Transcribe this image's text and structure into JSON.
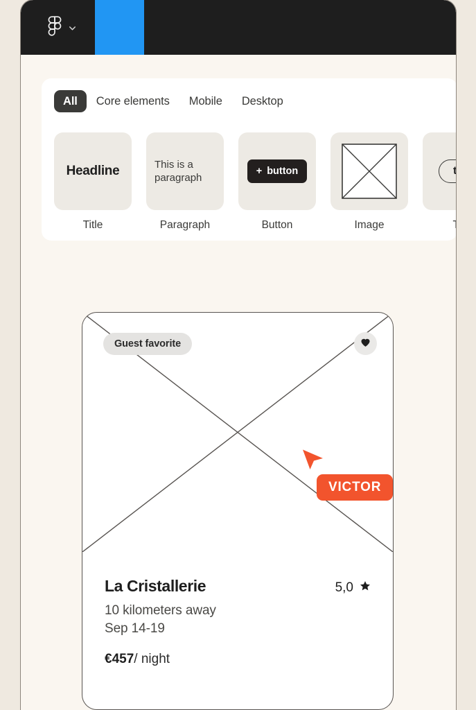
{
  "window": {
    "topbar": {
      "logo_icon": "figma-logo-icon",
      "dropdown_icon": "chevron-down-icon",
      "active_tab_color": "#2196F3"
    }
  },
  "elements_panel": {
    "tabs": [
      {
        "label": "All",
        "active": true
      },
      {
        "label": "Core elements",
        "active": false
      },
      {
        "label": "Mobile",
        "active": false
      },
      {
        "label": "Desktop",
        "active": false
      }
    ],
    "cards": [
      {
        "caption": "Title",
        "preview": "Headline",
        "kind": "headline"
      },
      {
        "caption": "Paragraph",
        "preview": "This is a paragraph",
        "kind": "paragraph"
      },
      {
        "caption": "Button",
        "preview": "button",
        "plus": "+",
        "kind": "button"
      },
      {
        "caption": "Image",
        "preview": "",
        "kind": "image"
      },
      {
        "caption": "Tag",
        "preview": "tag",
        "kind": "tag"
      }
    ]
  },
  "listing_card": {
    "badge": "Guest favorite",
    "favorite_icon": "heart-icon",
    "title": "La Cristallerie",
    "rating": "5,0",
    "rating_icon": "star-icon",
    "distance": "10 kilometers away",
    "dates": "Sep 14-19",
    "price_amount": "€457",
    "price_unit": "/ night"
  },
  "cursor": {
    "label": "VICTOR",
    "color": "#F2542D",
    "icon": "pointer-arrow-icon"
  }
}
